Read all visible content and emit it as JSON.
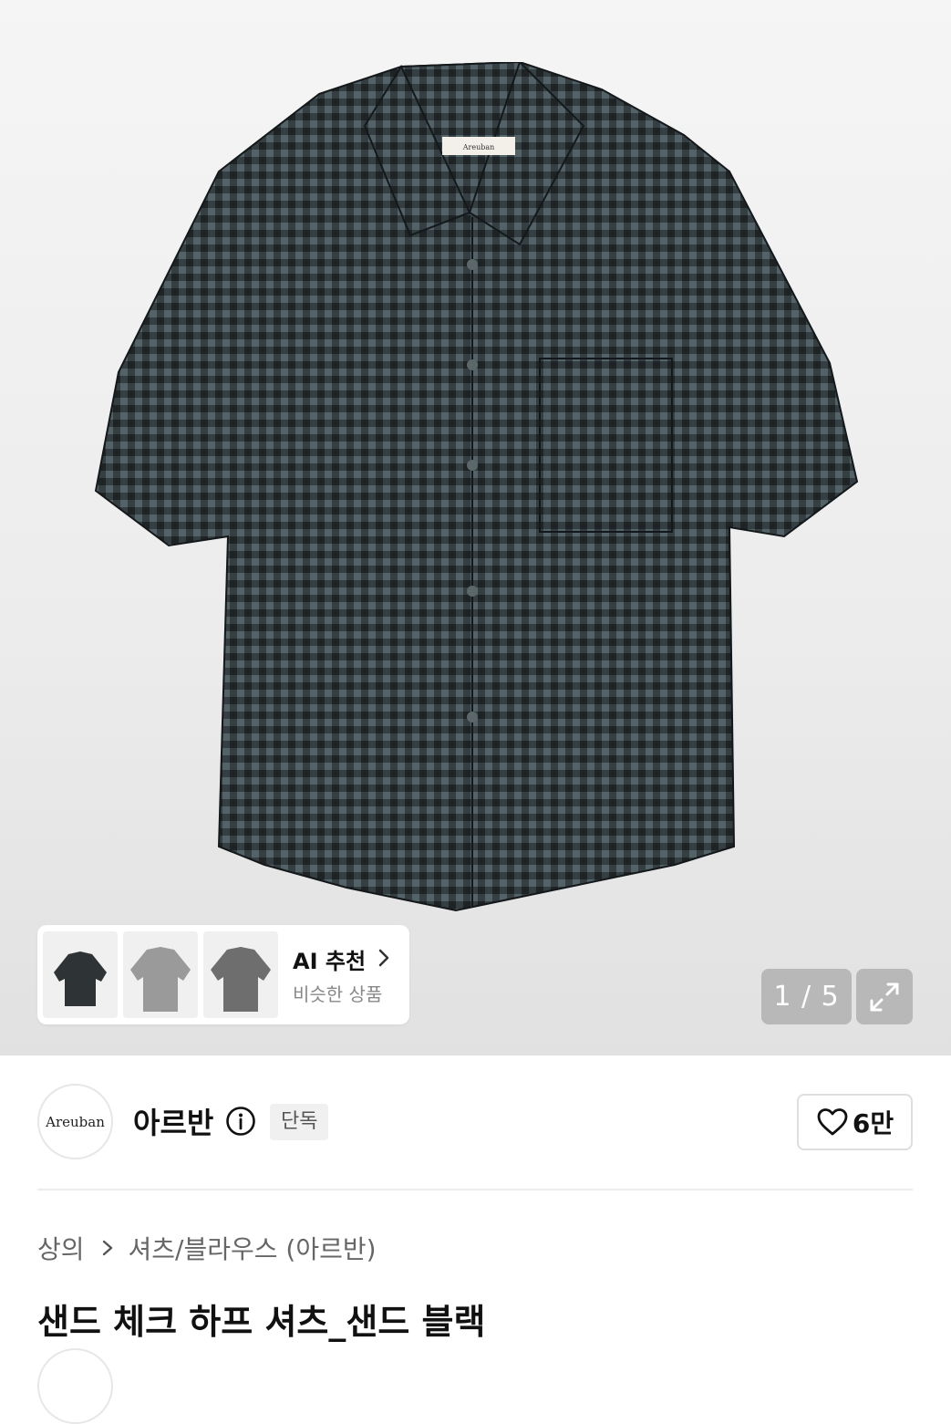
{
  "gallery": {
    "image_label": "Areuban",
    "pager": {
      "current": "1",
      "sep": " / ",
      "total": "5"
    },
    "ai_recommend": {
      "title": "AI 추천",
      "subtitle": "비슷한 상품"
    }
  },
  "brand": {
    "logo_text": "Areuban",
    "name": "아르반",
    "badge": "단독",
    "like_count": "6만"
  },
  "breadcrumb": {
    "items": [
      "상의",
      "셔츠/블라우스 (아르반)"
    ]
  },
  "product": {
    "title": "샌드 체크 하프 셔츠_샌드 블랙"
  },
  "colors": {
    "shirt_dark": "#1e2326",
    "shirt_check": "#4a5a5e",
    "thumb_light": "#9a9a9a",
    "thumb_mid": "#6e6e6e"
  }
}
